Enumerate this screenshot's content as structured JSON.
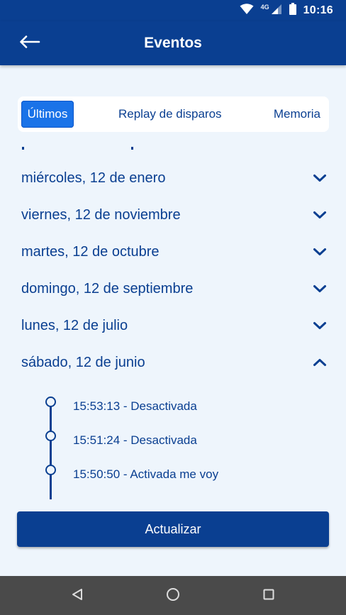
{
  "status_bar": {
    "time": "10:16",
    "network": "4G"
  },
  "app_bar": {
    "title": "Eventos"
  },
  "tabs": [
    {
      "label": "Últimos",
      "active": true
    },
    {
      "label": "Replay de disparos",
      "active": false
    },
    {
      "label": "Memoria",
      "active": false
    }
  ],
  "days": [
    {
      "label": "miércoles, 12 de enero",
      "expanded": false
    },
    {
      "label": "viernes, 12 de noviembre",
      "expanded": false
    },
    {
      "label": "martes, 12 de octubre",
      "expanded": false
    },
    {
      "label": "domingo, 12 de septiembre",
      "expanded": false
    },
    {
      "label": "lunes, 12 de julio",
      "expanded": false
    },
    {
      "label": "sábado, 12 de junio",
      "expanded": true
    }
  ],
  "events": [
    {
      "text": "15:53:13 - Desactivada"
    },
    {
      "text": "15:51:24 - Desactivada"
    },
    {
      "text": "15:50:50 - Activada me voy"
    }
  ],
  "actions": {
    "refresh_label": "Actualizar"
  },
  "colors": {
    "primary": "#0a3f91",
    "accent": "#1a73e8",
    "background": "#eef5fc",
    "nav_bar": "#4a4a4a"
  }
}
